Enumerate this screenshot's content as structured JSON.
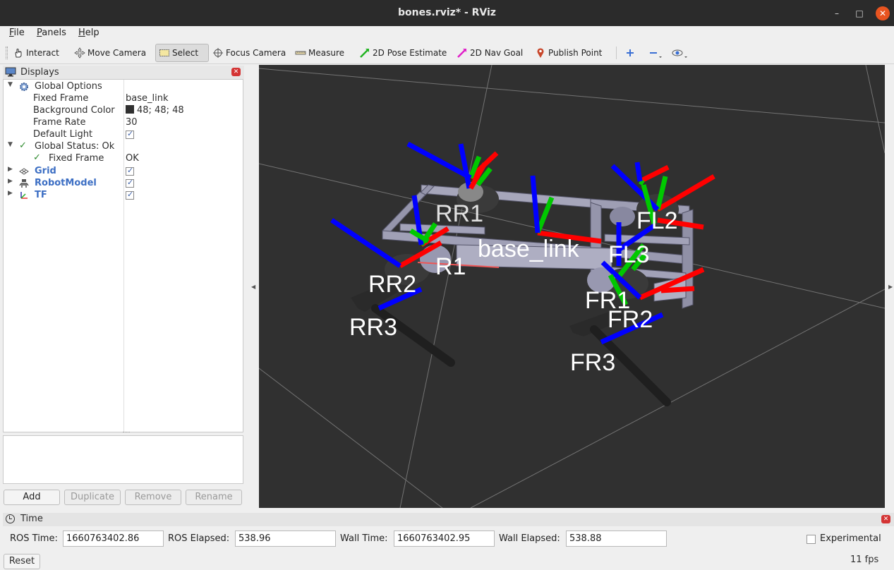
{
  "window": {
    "title": "bones.rviz* - RViz"
  },
  "menu": {
    "file": {
      "key": "F",
      "rest": "ile"
    },
    "panels": {
      "key": "P",
      "rest": "anels"
    },
    "help": {
      "key": "H",
      "rest": "elp"
    }
  },
  "toolbar": {
    "interact": "Interact",
    "move_camera": "Move Camera",
    "select": "Select",
    "focus_camera": "Focus Camera",
    "measure": "Measure",
    "pose_estimate": "2D Pose Estimate",
    "nav_goal": "2D Nav Goal",
    "publish_point": "Publish Point",
    "active_tool": "Select"
  },
  "displays": {
    "title": "Displays",
    "global_options": "Global Options",
    "fixed_frame_label": "Fixed Frame",
    "fixed_frame_value": "base_link",
    "background_color_label": "Background Color",
    "background_color_value": "48; 48; 48",
    "background_color_hex": "#303030",
    "frame_rate_label": "Frame Rate",
    "frame_rate_value": "30",
    "default_light_label": "Default Light",
    "default_light_checked": true,
    "global_status": "Global Status: Ok",
    "status_fixed_frame_label": "Fixed Frame",
    "status_fixed_frame_value": "OK",
    "grid": "Grid",
    "grid_checked": true,
    "robot_model": "RobotModel",
    "robot_model_checked": true,
    "tf": "TF",
    "tf_checked": true
  },
  "buttons": {
    "add": "Add",
    "duplicate": "Duplicate",
    "remove": "Remove",
    "rename": "Rename"
  },
  "viewport": {
    "frame_labels": [
      "base_link",
      "RR2",
      "RR3",
      "FR2",
      "FR3"
    ],
    "axis_colors": {
      "x": "#ff0000",
      "y": "#00c800",
      "z": "#0000ff"
    }
  },
  "time": {
    "title": "Time",
    "ros_time_label": "ROS Time:",
    "ros_time": "1660763402.86",
    "ros_elapsed_label": "ROS Elapsed:",
    "ros_elapsed": "538.96",
    "wall_time_label": "Wall Time:",
    "wall_time": "1660763402.95",
    "wall_elapsed_label": "Wall Elapsed:",
    "wall_elapsed": "538.88",
    "experimental_label": "Experimental",
    "experimental_checked": false,
    "reset": "Reset",
    "fps": "11 fps"
  }
}
